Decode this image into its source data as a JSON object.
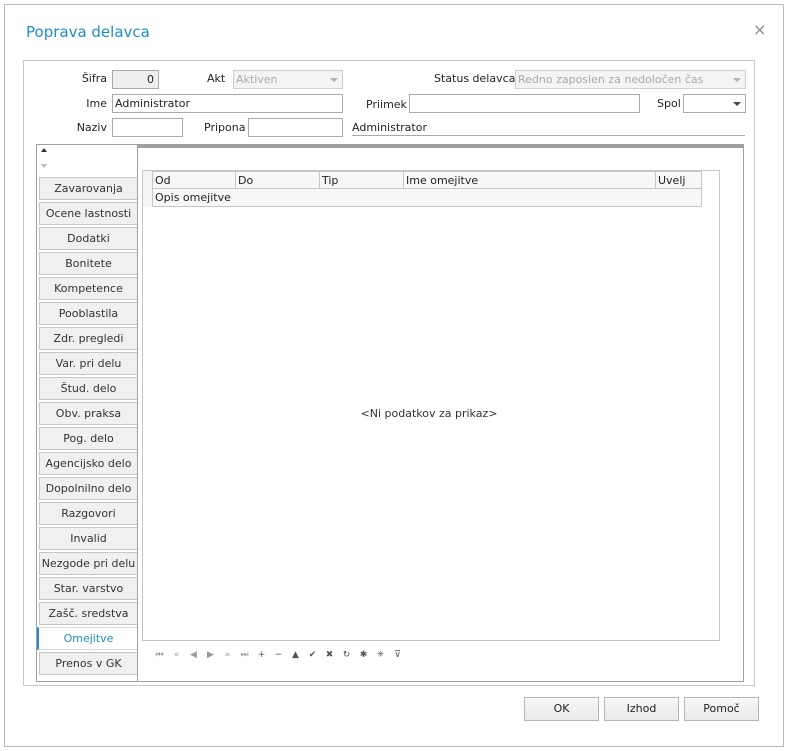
{
  "dialog": {
    "title": "Poprava delavca",
    "close_glyph": "×"
  },
  "form": {
    "sifra_label": "Šifra",
    "sifra_value": "0",
    "akt_label": "Akt",
    "akt_value": "Aktiven",
    "status_label": "Status delavca",
    "status_value": "Redno zaposlen za nedoločen čas",
    "ime_label": "Ime",
    "ime_value": "Administrator",
    "priimek_label": "Priimek",
    "priimek_value": "",
    "spol_label": "Spol",
    "spol_value": "",
    "naziv_label": "Naziv",
    "naziv_value": "",
    "pripona_label": "Pripona",
    "pripona_value": "",
    "display_name": "Administrator"
  },
  "tabs": [
    {
      "label": "Zavarovanja"
    },
    {
      "label": "Ocene lastnosti"
    },
    {
      "label": "Dodatki"
    },
    {
      "label": "Bonitete"
    },
    {
      "label": "Kompetence"
    },
    {
      "label": "Pooblastila"
    },
    {
      "label": "Zdr. pregledi"
    },
    {
      "label": "Var. pri delu"
    },
    {
      "label": "Štud. delo"
    },
    {
      "label": "Obv. praksa"
    },
    {
      "label": "Pog. delo"
    },
    {
      "label": "Agencijsko delo"
    },
    {
      "label": "Dopolnilno delo"
    },
    {
      "label": "Razgovori"
    },
    {
      "label": "Invalid"
    },
    {
      "label": "Nezgode pri delu"
    },
    {
      "label": "Star. varstvo"
    },
    {
      "label": "Zašč. sredstva"
    },
    {
      "label": "Omejitve"
    },
    {
      "label": "Prenos v GK"
    }
  ],
  "active_tab": "Omejitve",
  "grid": {
    "columns": [
      "Od",
      "Do",
      "Tip",
      "Ime omejitve",
      "Uvelj"
    ],
    "second_row": "Opis omejitve",
    "empty_text": "<Ni podatkov za prikaz>"
  },
  "navigator": [
    {
      "icon": "first-icon",
      "glyph": "⏮"
    },
    {
      "icon": "prev-page-icon",
      "glyph": "«"
    },
    {
      "icon": "prev-icon",
      "glyph": "◀"
    },
    {
      "icon": "next-icon",
      "glyph": "▶"
    },
    {
      "icon": "next-page-icon",
      "glyph": "»"
    },
    {
      "icon": "last-icon",
      "glyph": "⏭"
    },
    {
      "icon": "add-icon",
      "glyph": "+"
    },
    {
      "icon": "delete-icon",
      "glyph": "−"
    },
    {
      "icon": "edit-icon",
      "glyph": "▲"
    },
    {
      "icon": "post-icon",
      "glyph": "✔"
    },
    {
      "icon": "cancel-icon",
      "glyph": "✖"
    },
    {
      "icon": "refresh-icon",
      "glyph": "↻"
    },
    {
      "icon": "apply-filter-icon",
      "glyph": "✱"
    },
    {
      "icon": "clear-filter-icon",
      "glyph": "✳"
    },
    {
      "icon": "filter-icon",
      "glyph": "⊽"
    }
  ],
  "buttons": {
    "ok": "OK",
    "exit": "Izhod",
    "help": "Pomoč"
  },
  "colors": {
    "accent": "#1e8fc6"
  }
}
